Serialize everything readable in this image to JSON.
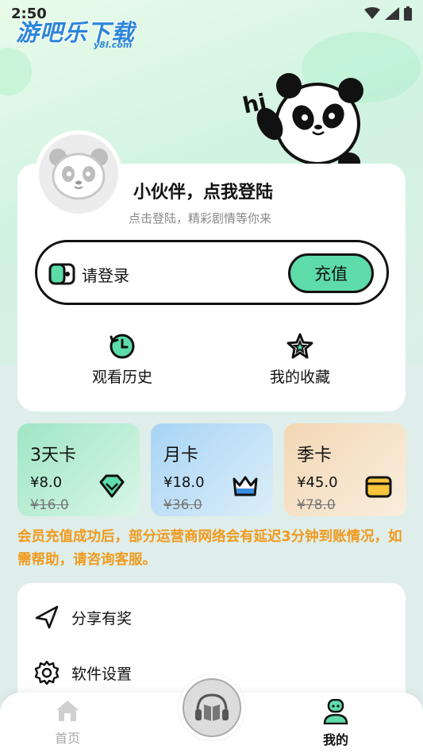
{
  "status_bar": {
    "time": "2:50"
  },
  "watermark": {
    "name": "游吧乐下载",
    "domain": "y8l.com"
  },
  "hero": {
    "greeting": "hi"
  },
  "profile": {
    "title": "小伙伴，点我登陆",
    "subtitle": "点击登陆，精彩剧情等你来"
  },
  "wallet": {
    "label": "请登录",
    "recharge_label": "充值"
  },
  "quick_actions": [
    {
      "label": "观看历史",
      "icon": "history-icon"
    },
    {
      "label": "我的收藏",
      "icon": "favorite-star-icon"
    }
  ],
  "vip_cards": [
    {
      "name": "3天卡",
      "price": "¥8.0",
      "original": "¥16.0",
      "icon": "diamond-icon",
      "bg": "#b5ecd2"
    },
    {
      "name": "月卡",
      "price": "¥18.0",
      "original": "¥36.0",
      "icon": "crown-icon",
      "bg": "#bfe0f5"
    },
    {
      "name": "季卡",
      "price": "¥45.0",
      "original": "¥78.0",
      "icon": "card-icon",
      "bg": "#f7e2c6"
    }
  ],
  "notice": "会员充值成功后，部分运营商网络会有延迟3分钟到账情况，如需帮助，请咨询客服。",
  "menu": [
    {
      "label": "分享有奖",
      "icon": "share-icon"
    },
    {
      "label": "软件设置",
      "icon": "settings-gear-icon"
    }
  ],
  "tabbar": {
    "home_label": "首页",
    "mine_label": "我的",
    "active": "mine"
  },
  "colors": {
    "accent": "#5ddcaa",
    "notice": "#f09a1e"
  }
}
